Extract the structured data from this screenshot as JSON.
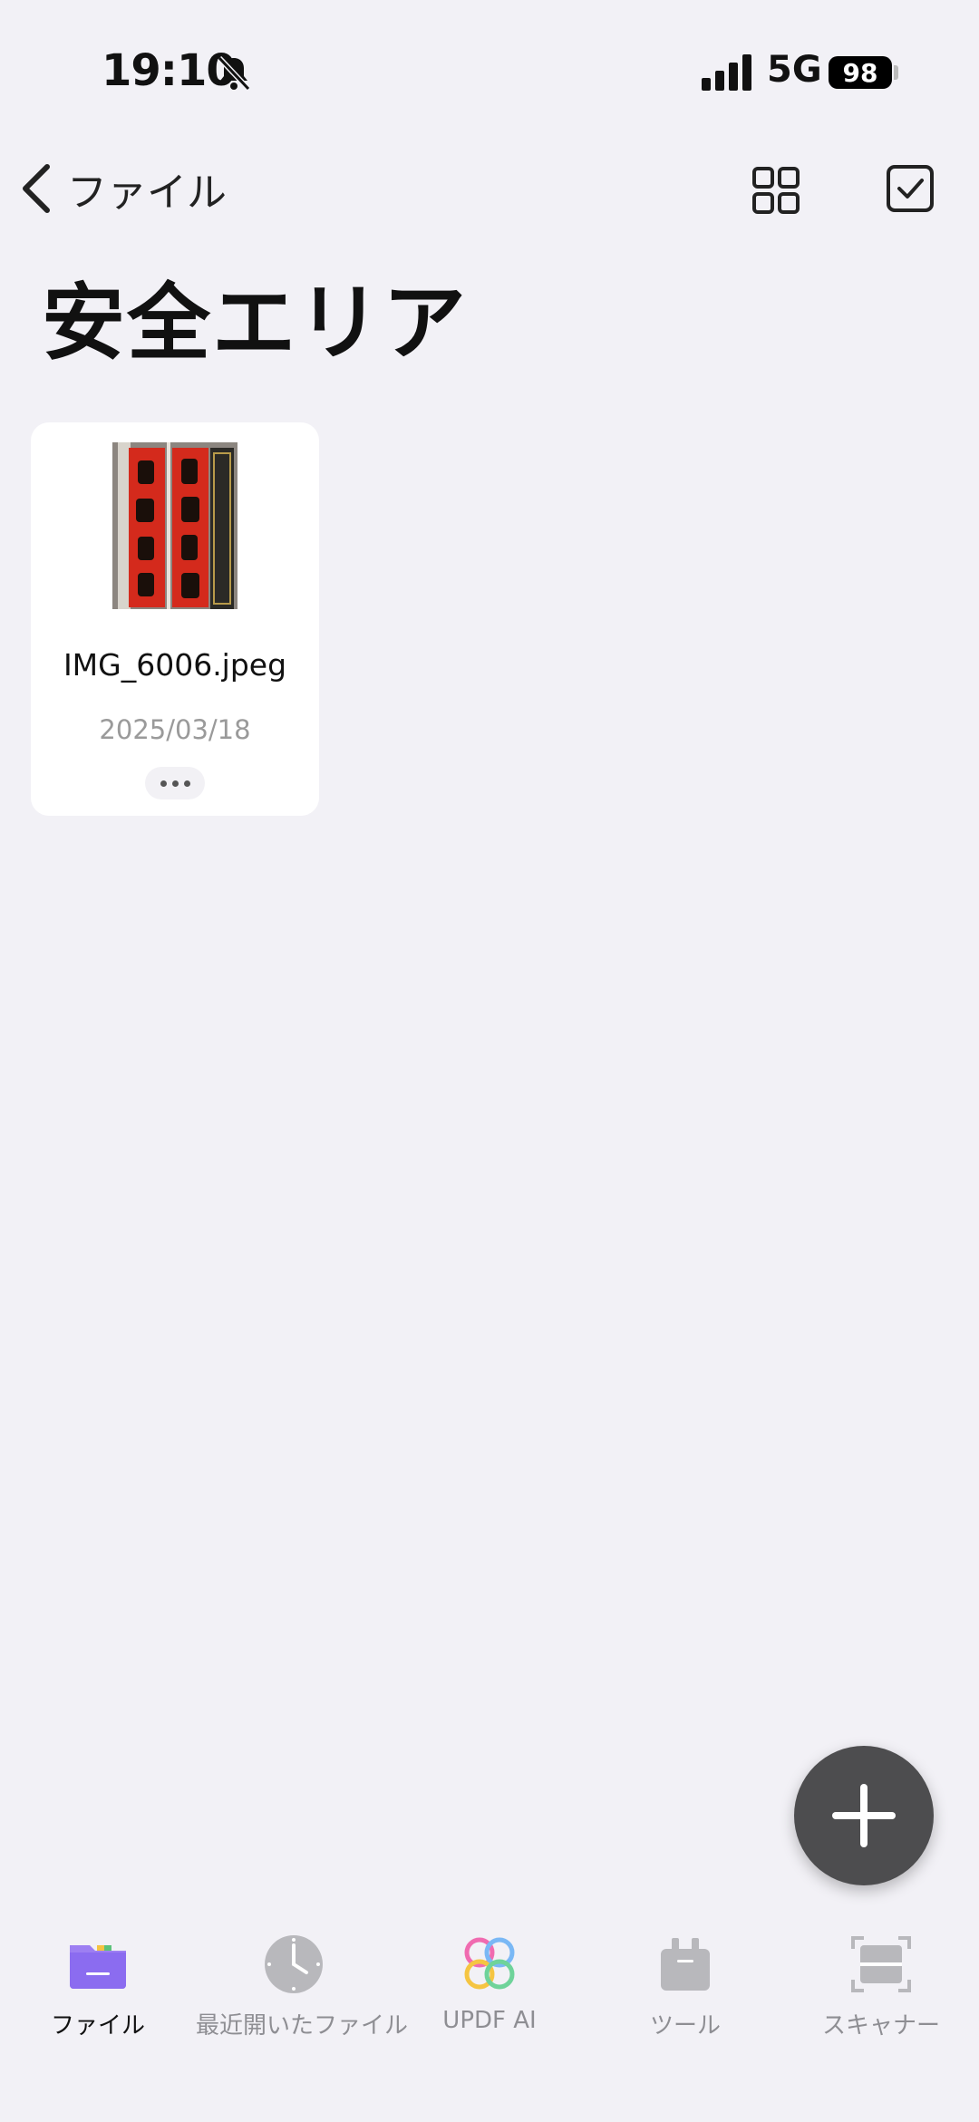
{
  "status_bar": {
    "time": "19:10",
    "network": "5G",
    "battery": "98"
  },
  "nav": {
    "back_label": "ファイル"
  },
  "page_title": "安全エリア",
  "files": [
    {
      "name": "IMG_6006.jpeg",
      "date": "2025/03/18"
    }
  ],
  "tab_bar": {
    "active": "ファイル",
    "items": [
      {
        "label": "ファイル",
        "icon": "folder-icon"
      },
      {
        "label": "最近開いたファイル",
        "icon": "clock-icon"
      },
      {
        "label": "UPDF AI",
        "icon": "updf-ai-icon"
      },
      {
        "label": "ツール",
        "icon": "toolbox-icon"
      },
      {
        "label": "スキャナー",
        "icon": "scanner-icon"
      }
    ]
  },
  "colors": {
    "background": "#f2f1f6",
    "folder_accent": "#8b6cf0",
    "fab": "#4d4d4f"
  }
}
